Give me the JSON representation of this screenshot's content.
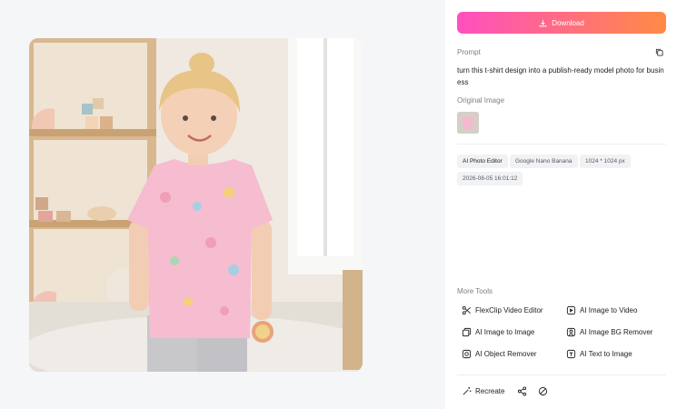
{
  "download": {
    "label": "Download"
  },
  "prompt": {
    "label": "Prompt",
    "text": "turn this t-shirt design into a publish-ready model photo for business"
  },
  "original_image": {
    "label": "Original Image"
  },
  "tags": [
    {
      "label": "AI Photo Editor"
    },
    {
      "label": "Google Nano Banana"
    },
    {
      "label": "1024 * 1024 px"
    },
    {
      "label": "2026-08-05 16:01:12"
    }
  ],
  "more_tools": {
    "label": "More Tools",
    "items": [
      {
        "label": "FlexClip Video Editor",
        "icon": "scissors-icon"
      },
      {
        "label": "AI Image to Video",
        "icon": "image-video-icon"
      },
      {
        "label": "AI Image to Image",
        "icon": "images-icon"
      },
      {
        "label": "AI Image BG Remover",
        "icon": "bg-remover-icon"
      },
      {
        "label": "AI Object Remover",
        "icon": "object-remover-icon"
      },
      {
        "label": "AI Text to Image",
        "icon": "text-image-icon"
      }
    ]
  },
  "actions": {
    "recreate": "Recreate",
    "share_icon": "share-icon",
    "no_icon": "hide-icon"
  },
  "colors": {
    "gradient_start": "#ff4fc0",
    "gradient_end": "#ff8a45",
    "page_bg": "#f5f6f8"
  }
}
